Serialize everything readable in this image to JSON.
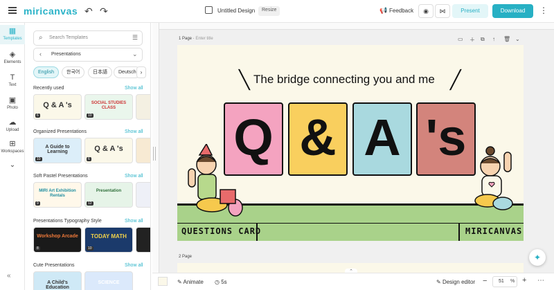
{
  "header": {
    "logo": "miricanvas",
    "doc_title": "Untitled Design",
    "resize_label": "Resize",
    "feedback_label": "Feedback",
    "present_label": "Present",
    "download_label": "Download"
  },
  "rail": {
    "items": [
      {
        "label": "Templates",
        "icon": "grid-icon"
      },
      {
        "label": "Elements",
        "icon": "shapes-icon"
      },
      {
        "label": "Text",
        "icon": "text-icon"
      },
      {
        "label": "Photo",
        "icon": "photo-icon"
      },
      {
        "label": "Upload",
        "icon": "upload-icon"
      },
      {
        "label": "Workspaces",
        "icon": "workspace-icon"
      }
    ]
  },
  "panel": {
    "search_placeholder": "Search Templates",
    "category": "Presentations",
    "chips": [
      "English",
      "한국어",
      "日本語",
      "Deutsch"
    ],
    "show_all": "Show all",
    "sections": [
      {
        "title": "Recently used",
        "thumbs": [
          {
            "label": "Q & A 's",
            "num": "6"
          },
          {
            "label": "SOCIAL STUDIES CLASS",
            "num": "10"
          }
        ]
      },
      {
        "title": "Organized Presentations",
        "thumbs": [
          {
            "label": "A Guide to Learning",
            "num": "10"
          },
          {
            "label": "Q & A 's",
            "num": "6"
          }
        ]
      },
      {
        "title": "Soft Pastel Presentations",
        "thumbs": [
          {
            "label": "MIRI Art Exhibition Rentals",
            "num": "9"
          },
          {
            "label": "Presentation",
            "num": "12"
          }
        ]
      },
      {
        "title": "Presentations Typography Style",
        "thumbs": [
          {
            "label": "Workshop Arcade",
            "num": "8"
          },
          {
            "label": "TODAY MATH",
            "num": "10"
          }
        ]
      },
      {
        "title": "Cute Presentations",
        "thumbs": [
          {
            "label": "A Child's Education",
            "num": ""
          },
          {
            "label": "SCIENCE",
            "num": ""
          }
        ]
      }
    ]
  },
  "canvas": {
    "page1_label": "1 Page",
    "page1_placeholder": "Enter title",
    "page2_label": "2 Page",
    "tagline": "The bridge connecting you and me",
    "cards": [
      "Q",
      "&",
      "A",
      "'s"
    ],
    "footer_left": "QUESTIONS CARD",
    "footer_right": "MIRICANVAS"
  },
  "bottom": {
    "animate_label": "Animate",
    "timer_label": "5s",
    "design_editor_label": "Design editor",
    "zoom": "51",
    "zoom_unit": "%"
  },
  "colors": {
    "accent": "#27b0c4",
    "card_pink": "#f4a3c0",
    "card_yellow": "#f9cf5e",
    "card_blue": "#a9d9df",
    "card_rose": "#d3847c",
    "slide_bg": "#fbf8e9",
    "ground": "#a9d28a"
  }
}
